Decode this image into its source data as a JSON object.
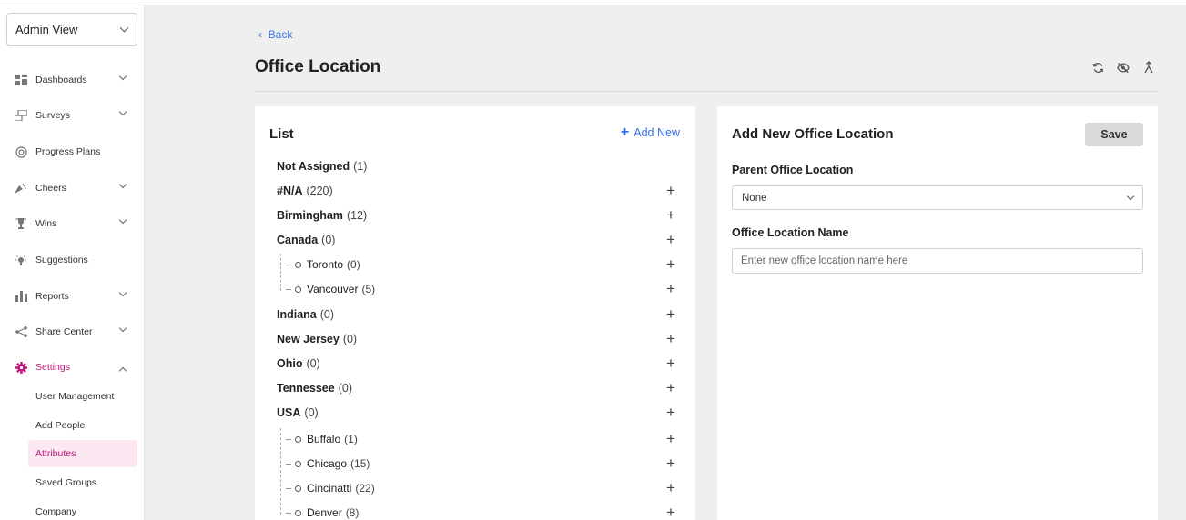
{
  "sidebar": {
    "view_select": "Admin View",
    "nav": [
      {
        "label": "Dashboards",
        "icon": "dashboard-icon",
        "has_chevron": true
      },
      {
        "label": "Surveys",
        "icon": "survey-icon",
        "has_chevron": true
      },
      {
        "label": "Progress Plans",
        "icon": "target-icon",
        "has_chevron": false
      },
      {
        "label": "Cheers",
        "icon": "party-icon",
        "has_chevron": true
      },
      {
        "label": "Wins",
        "icon": "trophy-icon",
        "has_chevron": true
      },
      {
        "label": "Suggestions",
        "icon": "lightbulb-icon",
        "has_chevron": false
      },
      {
        "label": "Reports",
        "icon": "bar-chart-icon",
        "has_chevron": true
      },
      {
        "label": "Share Center",
        "icon": "share-icon",
        "has_chevron": true
      },
      {
        "label": "Settings",
        "icon": "gear-icon",
        "has_chevron": true,
        "expanded": true
      }
    ],
    "settings_sub": [
      {
        "label": "User Management"
      },
      {
        "label": "Add People"
      },
      {
        "label": "Attributes",
        "active": true
      },
      {
        "label": "Saved Groups"
      },
      {
        "label": "Company"
      }
    ]
  },
  "header": {
    "back_label": "Back",
    "title": "Office Location"
  },
  "list_panel": {
    "heading": "List",
    "add_new_label": "Add New",
    "items": [
      {
        "name": "Not Assigned",
        "count": "(1)",
        "level": 0,
        "has_plus": false
      },
      {
        "name": "#N/A",
        "count": "(220)",
        "level": 0,
        "has_plus": true
      },
      {
        "name": "Birmingham",
        "count": "(12)",
        "level": 0,
        "has_plus": true
      },
      {
        "name": "Canada",
        "count": "(0)",
        "level": 0,
        "has_plus": true
      },
      {
        "name": "Toronto",
        "count": "(0)",
        "level": 1,
        "has_plus": true
      },
      {
        "name": "Vancouver",
        "count": "(5)",
        "level": 1,
        "has_plus": true
      },
      {
        "name": "Indiana",
        "count": "(0)",
        "level": 0,
        "has_plus": true
      },
      {
        "name": "New Jersey",
        "count": "(0)",
        "level": 0,
        "has_plus": true
      },
      {
        "name": "Ohio",
        "count": "(0)",
        "level": 0,
        "has_plus": true
      },
      {
        "name": "Tennessee",
        "count": "(0)",
        "level": 0,
        "has_plus": true
      },
      {
        "name": "USA",
        "count": "(0)",
        "level": 0,
        "has_plus": true
      },
      {
        "name": "Buffalo",
        "count": "(1)",
        "level": 1,
        "has_plus": true
      },
      {
        "name": "Chicago",
        "count": "(15)",
        "level": 1,
        "has_plus": true
      },
      {
        "name": "Cincinatti",
        "count": "(22)",
        "level": 1,
        "has_plus": true
      },
      {
        "name": "Denver",
        "count": "(8)",
        "level": 1,
        "has_plus": true
      }
    ]
  },
  "form_panel": {
    "heading": "Add New Office Location",
    "save_label": "Save",
    "parent_label": "Parent Office Location",
    "parent_value": "None",
    "name_label": "Office Location Name",
    "name_placeholder": "Enter new office location name here"
  },
  "colors": {
    "accent": "#c2167a",
    "link": "#3a6df0",
    "active_bg": "#fbe8f3"
  }
}
